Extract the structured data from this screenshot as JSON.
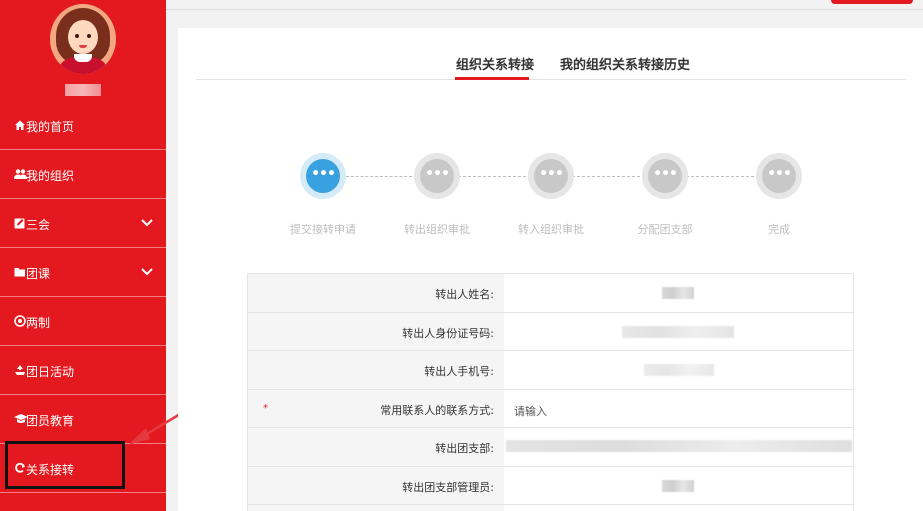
{
  "sidebar": {
    "items": [
      {
        "label": "我的首页",
        "icon": "home-icon"
      },
      {
        "label": "我的组织",
        "icon": "users-icon"
      },
      {
        "label": "三会",
        "icon": "edit-icon",
        "expandable": true
      },
      {
        "label": "团课",
        "icon": "folder-icon",
        "expandable": true
      },
      {
        "label": "两制",
        "icon": "target-icon"
      },
      {
        "label": "团日活动",
        "icon": "recycle-icon"
      },
      {
        "label": "团员教育",
        "icon": "graduation-cap-icon"
      },
      {
        "label": "关系接转",
        "icon": "refresh-icon"
      }
    ]
  },
  "tabs": [
    {
      "label": "组织关系转接",
      "active": true
    },
    {
      "label": "我的组织关系转接历史",
      "active": false
    }
  ],
  "steps": [
    {
      "label": "提交接转申请",
      "active": true,
      "glyph": "•••"
    },
    {
      "label": "转出组织审批",
      "active": false,
      "glyph": "•••"
    },
    {
      "label": "转入组织审批",
      "active": false,
      "glyph": "•••"
    },
    {
      "label": "分配团支部",
      "active": false,
      "glyph": "•••"
    },
    {
      "label": "完成",
      "active": false,
      "glyph": "•••"
    }
  ],
  "form": {
    "rows": [
      {
        "label": "转出人姓名:",
        "required": false
      },
      {
        "label": "转出人身份证号码:",
        "required": false
      },
      {
        "label": "转出人手机号:",
        "required": false
      },
      {
        "label": "常用联系人的联系方式:",
        "required": true,
        "required_mark": "*",
        "placeholder": "请输入"
      },
      {
        "label": "转出团支部:",
        "required": false
      },
      {
        "label": "转出团支部管理员:",
        "required": false
      }
    ]
  },
  "colors": {
    "brand_red": "#e4191f",
    "active_step": "#3aa1e0"
  }
}
